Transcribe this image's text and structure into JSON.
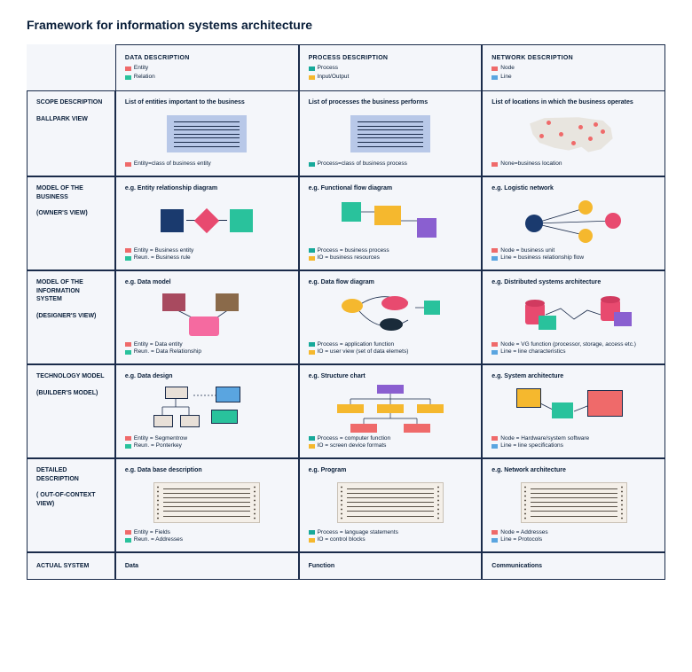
{
  "title": "Framework for information systems architecture",
  "columns": {
    "data": {
      "header": "DATA DESCRIPTION",
      "leg1": "Entity",
      "leg2": "Relation"
    },
    "process": {
      "header": "PROCESS DESCRIPTION",
      "leg1": "Process",
      "leg2": "Input/Output"
    },
    "network": {
      "header": "NETWORK DESCRIPTION",
      "leg1": "Node",
      "leg2": "Line"
    }
  },
  "rows": {
    "scope": {
      "label1": "SCOPE DESCRIPTION",
      "label2": "BALLPARK VIEW",
      "data": {
        "title": "List of entities important to the business",
        "cap1": "Entity=class of business entity"
      },
      "process": {
        "title": "List of processes the business performs",
        "cap1": "Process=class of business process"
      },
      "network": {
        "title": "List of locations in which the business operates",
        "cap1": "None=business location"
      }
    },
    "owner": {
      "label1": "MODEL OF THE BUSINESS",
      "label2": "(OWNER'S VIEW)",
      "data": {
        "title": "e.g. Entity relationship diagram",
        "cap1": "Entity = Business entity",
        "cap2": "Reun. = Business rule"
      },
      "process": {
        "title": "e.g. Functional flow diagram",
        "cap1": "Process = business process",
        "cap2": "IO = business resources"
      },
      "network": {
        "title": "e.g. Logistic network",
        "cap1": "Node = business unit",
        "cap2": "Line = business relationship flow"
      }
    },
    "designer": {
      "label1": "MODEL OF THE INFORMATION SYSTEM",
      "label2": "(DESIGNER'S VIEW)",
      "data": {
        "title": "e.g. Data model",
        "cap1": "Entity = Data entity",
        "cap2": "Reun. = Data Relationship"
      },
      "process": {
        "title": "e.g. Data flow diagram",
        "cap1": "Process = application function",
        "cap2": "IO = user view (set of data elemets)"
      },
      "network": {
        "title": "e.g. Distributed systems architecture",
        "cap1": "Node = VG function (processor, storage, access etc.)",
        "cap2": "Line = line characteristics"
      }
    },
    "builder": {
      "label1": "TECHNOLOGY MODEL",
      "label2": "(BUILDER'S MODEL)",
      "data": {
        "title": "e.g. Data design",
        "cap1": "Entity = Segmentrow",
        "cap2": "Reun. = Ponterkey"
      },
      "process": {
        "title": "e.g. Structure chart",
        "cap1": "Process = computer function",
        "cap2": "IO = screen device formats"
      },
      "network": {
        "title": "e.g. System architecture",
        "cap1": "Node = Hardware/system software",
        "cap2": "Line = line specifications"
      }
    },
    "detailed": {
      "label1": "DETAILED DESCRIPTION",
      "label2": "( OUT-OF-CONTEXT VIEW)",
      "data": {
        "title": "e.g. Data base description",
        "cap1": "Entity = Fields",
        "cap2": "Reun. = Addresses"
      },
      "process": {
        "title": "e.g. Program",
        "cap1": "Process = language statements",
        "cap2": "IO = control blocks"
      },
      "network": {
        "title": "e.g. Network architecture",
        "cap1": "Node = Addresses",
        "cap2": "Line = Protocols"
      }
    },
    "actual": {
      "label": "ACTUAL SYSTEM",
      "data": "Data",
      "process": "Function",
      "network": "Communications"
    }
  }
}
